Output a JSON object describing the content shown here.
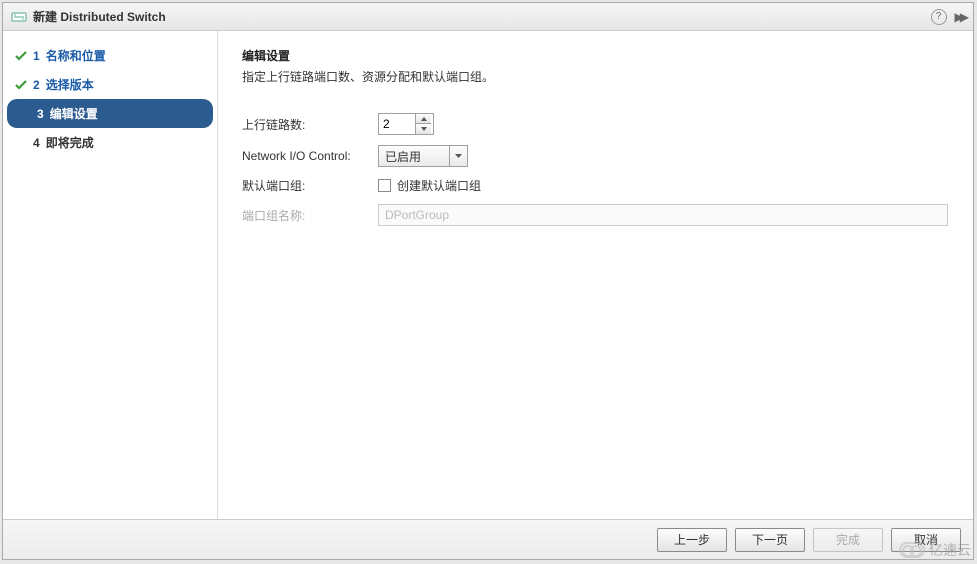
{
  "dialog": {
    "title": "新建 Distributed Switch"
  },
  "steps": [
    {
      "num": "1",
      "label": "名称和位置",
      "state": "completed"
    },
    {
      "num": "2",
      "label": "选择版本",
      "state": "completed"
    },
    {
      "num": "3",
      "label": "编辑设置",
      "state": "active"
    },
    {
      "num": "4",
      "label": "即将完成",
      "state": "pending"
    }
  ],
  "panel": {
    "heading": "编辑设置",
    "subheading": "指定上行链路端口数、资源分配和默认端口组。"
  },
  "form": {
    "uplinks_label": "上行链路数:",
    "uplinks_value": "2",
    "nioc_label": "Network I/O Control:",
    "nioc_value": "已启用",
    "default_pg_label": "默认端口组:",
    "default_pg_checkbox_label": "创建默认端口组",
    "default_pg_checked": false,
    "pg_name_label": "端口组名称:",
    "pg_name_placeholder": "DPortGroup"
  },
  "footer": {
    "back": "上一步",
    "next": "下一页",
    "finish": "完成",
    "cancel": "取消"
  },
  "watermark": "亿速云"
}
